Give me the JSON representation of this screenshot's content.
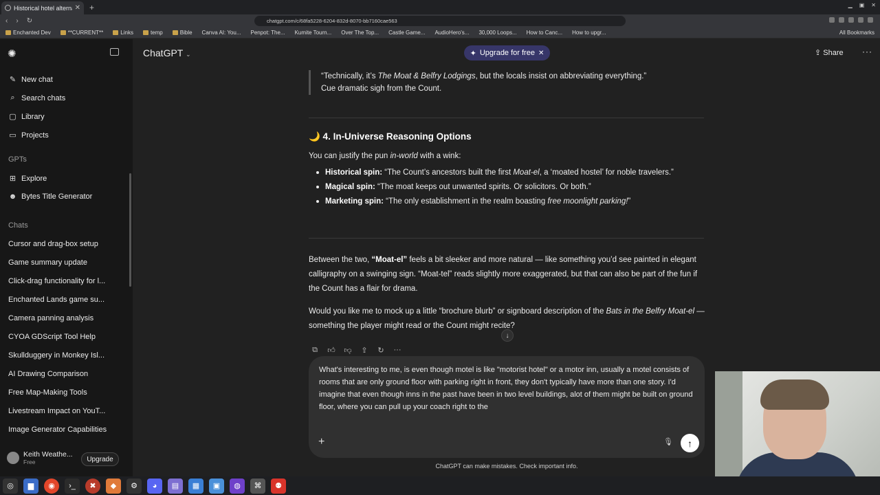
{
  "browser": {
    "tab_title": "Historical hotel alterna",
    "url": "chatgpt.com/c/68fa5228-6204-832d-8070-bb7160cae563",
    "bookmarks": [
      "Enchanted Dev",
      "**CURRENT**",
      "Links",
      "temp",
      "Bible",
      "Canva AI: You...",
      "Penpot: The...",
      "Kumite Tourn...",
      "Over The Top...",
      "Castle Game...",
      "AudioHero's...",
      "30,000 Loops...",
      "How to Canc...",
      "How to upgr..."
    ],
    "all_bookmarks": "All Bookmarks"
  },
  "sidebar": {
    "nav": [
      {
        "label": "New chat",
        "icon": "✎"
      },
      {
        "label": "Search chats",
        "icon": "⌕"
      },
      {
        "label": "Library",
        "icon": "▢"
      },
      {
        "label": "Projects",
        "icon": "▭"
      }
    ],
    "gpts_label": "GPTs",
    "gpts": [
      {
        "label": "Explore",
        "icon": "⊞"
      },
      {
        "label": "Bytes Title Generator",
        "icon": "☻"
      }
    ],
    "chats_label": "Chats",
    "chats": [
      "Cursor and drag-box setup",
      "Game summary update",
      "Click-drag functionality for l...",
      "Enchanted Lands game su...",
      "Camera panning analysis",
      "CYOA GDScript Tool Help",
      "Skullduggery in Monkey Isl...",
      "AI Drawing Comparison",
      "Free Map-Making Tools",
      "Livestream Impact on YouT...",
      "Image Generator Capabilities"
    ],
    "user_name": "Keith Weathe...",
    "user_plan": "Free",
    "upgrade_label": "Upgrade"
  },
  "header": {
    "model": "ChatGPT",
    "upgrade_pill": "Upgrade for free",
    "share": "Share"
  },
  "conversation": {
    "quote_1a": "“Technically, it’s ",
    "quote_1b": "The Moat & Belfry Lodgings",
    "quote_1c": ", but the locals insist on abbreviating everything.”",
    "quote_2": "Cue dramatic sigh from the Count.",
    "heading": "🌙 4. In-Universe Reasoning Options",
    "intro_a": "You can justify the pun ",
    "intro_b": "in-world",
    "intro_c": " with a wink:",
    "bullet_1_label": "Historical spin:",
    "bullet_1_a": " “The Count’s ancestors built the first ",
    "bullet_1_b": "Moat-el",
    "bullet_1_c": ", a ‘moated hostel’ for noble travelers.”",
    "bullet_2_label": "Magical spin:",
    "bullet_2_text": " “The moat keeps out unwanted spirits. Or solicitors. Or both.”",
    "bullet_3_label": "Marketing spin:",
    "bullet_3_a": " “The only establishment in the realm boasting ",
    "bullet_3_b": "free moonlight parking!",
    "bullet_3_c": "”",
    "para_1a": "Between the two, ",
    "para_1b": "“Moat-el”",
    "para_1c": " feels a bit sleeker and more natural — like something you’d see painted in elegant calligraphy on a swinging sign. “Moat-tel” reads slightly more exaggerated, but that can also be part of the fun if the Count has a flair for drama.",
    "para_2a": "Would you like me to mock up a little “brochure blurb” or signboard description of the ",
    "para_2b": "Bats in the Belfry Moat-el",
    "para_2c": " — something the player might read or the Count might recite?"
  },
  "composer": {
    "text": "What's interesting to me, is even though motel is like \"motorist hotel\" or a motor inn, usually a motel consists of rooms that are only ground floor with parking right in front, they don't typically have more than one story.  I'd imagine that even though inns in the past have been in two level buildings, alot of them might be built on ground floor, where you can pull up your coach right to the"
  },
  "disclaimer": "ChatGPT can make mistakes. Check important info."
}
